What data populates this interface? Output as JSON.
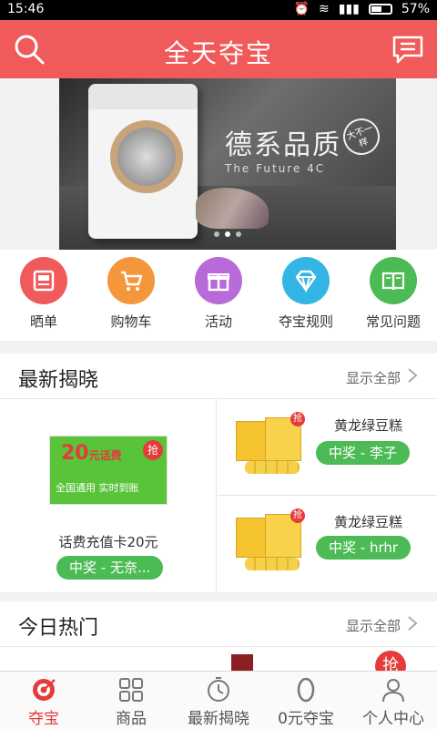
{
  "status": {
    "time": "15:46",
    "battery": "57%",
    "battery_level": 0.57
  },
  "header": {
    "title": "全天夺宝",
    "left_icon": "search-icon",
    "right_icon": "message-icon"
  },
  "banner": {
    "slogan": "德系品质",
    "subtitle": "The Future 4C",
    "seal": "大不一样",
    "dots": 3,
    "active_dot": 1
  },
  "categories": [
    {
      "label": "晒单",
      "icon": "share-order-icon",
      "color": "#f05a5a"
    },
    {
      "label": "购物车",
      "icon": "cart-icon",
      "color": "#f4963b"
    },
    {
      "label": "活动",
      "icon": "gift-icon",
      "color": "#b86ad8"
    },
    {
      "label": "夺宝规则",
      "icon": "diamond-icon",
      "color": "#33b5e5"
    },
    {
      "label": "常见问题",
      "icon": "book-icon",
      "color": "#4cbb55"
    }
  ],
  "latest": {
    "title": "最新揭晓",
    "more": "显示全部",
    "left": {
      "card_amount": "20",
      "card_unit": "元话费",
      "card_badge": "抢",
      "card_line": "全国通用  实时到账",
      "product": "话费充值卡20元",
      "winner": "中奖 - 无奈..."
    },
    "right": [
      {
        "product": "黄龙绿豆糕",
        "badge": "抢",
        "winner": "中奖 - 李子"
      },
      {
        "product": "黄龙绿豆糕",
        "badge": "抢",
        "winner": "中奖 - hrhr"
      }
    ]
  },
  "hot": {
    "title": "今日热门",
    "more": "显示全部",
    "badge": "抢"
  },
  "tabs": [
    {
      "label": "夺宝",
      "icon": "target-icon",
      "active": true
    },
    {
      "label": "商品",
      "icon": "grid-icon",
      "active": false
    },
    {
      "label": "最新揭晓",
      "icon": "timer-icon",
      "active": false
    },
    {
      "label": "0元夺宝",
      "icon": "zero-icon",
      "active": false
    },
    {
      "label": "个人中心",
      "icon": "user-icon",
      "active": false
    }
  ],
  "colors": {
    "brand": "#f05a5a",
    "accent_green": "#4cbb55",
    "badge_red": "#e53b3b"
  }
}
